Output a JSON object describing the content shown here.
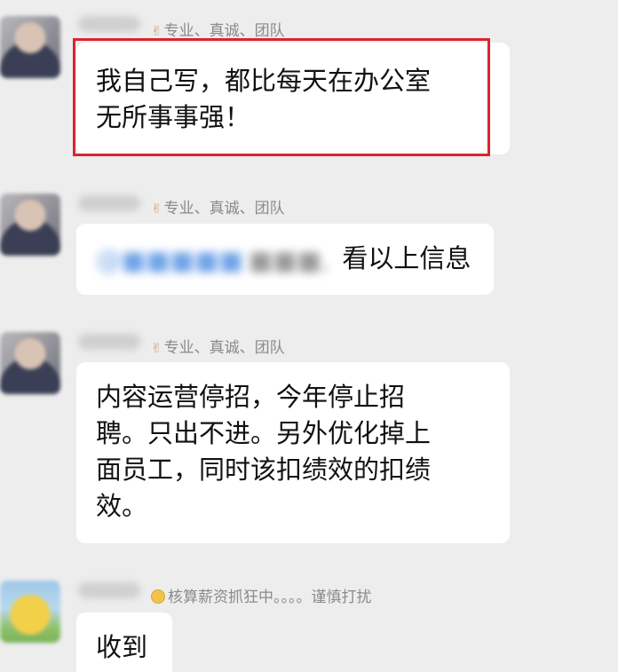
{
  "messages": [
    {
      "sender_signature": "专业、真诚、团队",
      "lines": [
        "我自己写，都比每天在办公室",
        "无所事事强！"
      ],
      "highlighted": true
    },
    {
      "sender_signature": "专业、真诚、团队",
      "text": "看以上信息"
    },
    {
      "sender_signature": "专业、真诚、团队",
      "lines": [
        "内容运营停招，今年停止招",
        "聘。只出不进。另外优化掉上",
        "面员工，同时该扣绩效的扣绩",
        "效。"
      ]
    },
    {
      "sender_signature": "核算薪资抓狂中。。。。谨慎打扰",
      "text": "收到"
    }
  ],
  "colors": {
    "background": "#ededed",
    "bubble": "#ffffff",
    "highlight_border": "#d9252f",
    "signature_text": "#8a8a8a"
  },
  "icons": {
    "signature_prefix": "hand-emoji-icon",
    "status_prefix": "smiley-emoji-icon"
  }
}
